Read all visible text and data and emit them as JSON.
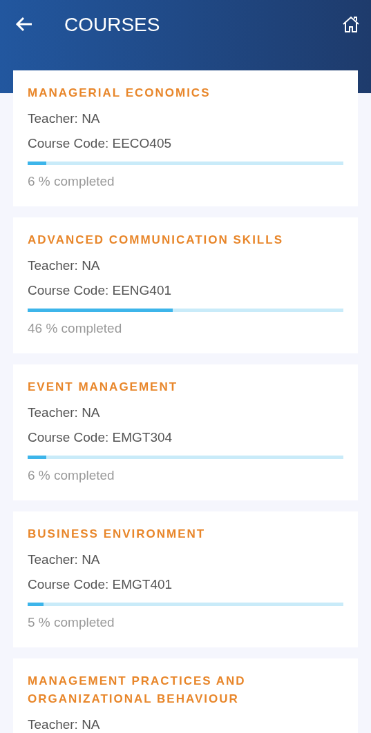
{
  "header": {
    "title": "COURSES"
  },
  "courses": [
    {
      "title": "MANAGERIAL ECONOMICS",
      "teacher": "Teacher: NA",
      "code": "Course Code: EECO405",
      "level": 0.06,
      "progress_text": "6 % completed"
    },
    {
      "title": "ADVANCED COMMUNICATION SKILLS",
      "teacher": "Teacher: NA",
      "code": "Course Code: EENG401",
      "level": 0.46,
      "progress_text": "46 % completed"
    },
    {
      "title": "EVENT MANAGEMENT",
      "teacher": "Teacher: NA",
      "code": "Course Code: EMGT304",
      "level": 0.06,
      "progress_text": "6 % completed"
    },
    {
      "title": "BUSINESS ENVIRONMENT",
      "teacher": "Teacher: NA",
      "code": "Course Code: EMGT401",
      "level": 0.05,
      "progress_text": "5 % completed"
    },
    {
      "title": "MANAGEMENT PRACTICES AND ORGANIZATIONAL BEHAVIOUR",
      "teacher": "Teacher: NA"
    }
  ]
}
